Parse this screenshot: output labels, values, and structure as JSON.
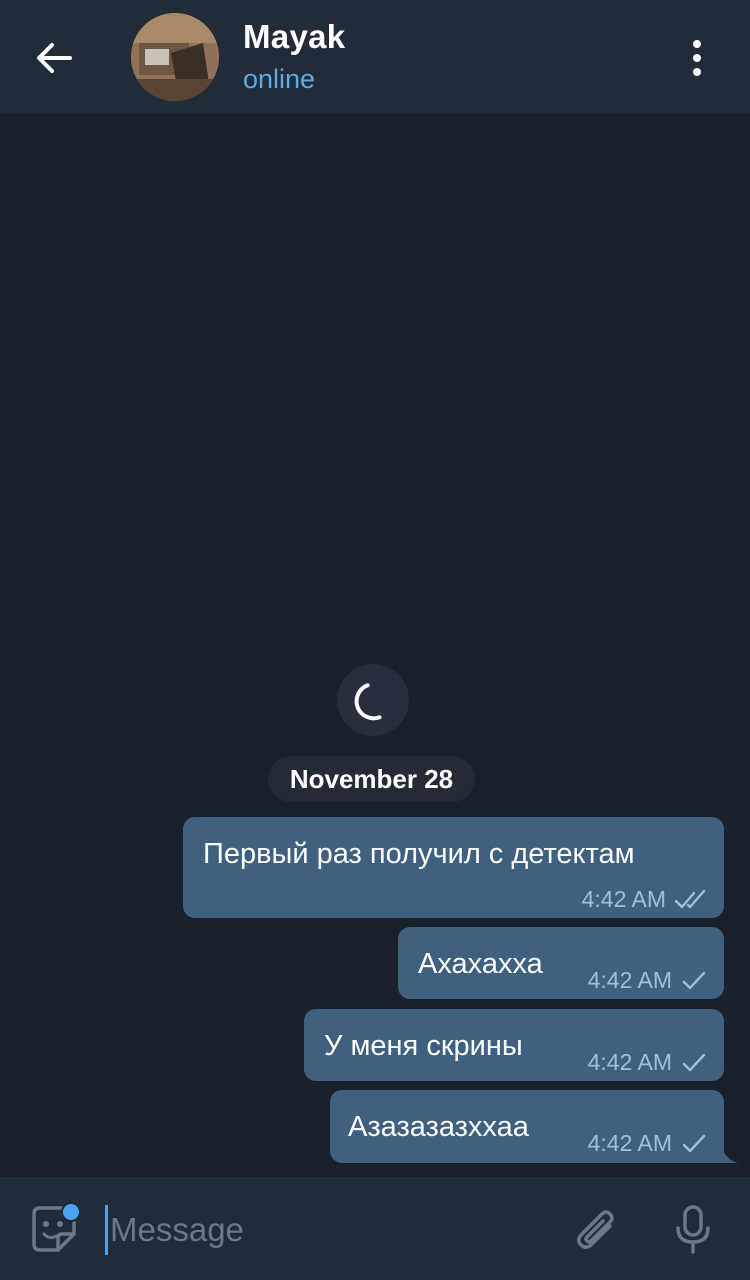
{
  "header": {
    "title": "Mayak",
    "status": "online",
    "back_icon": "arrow-left-icon",
    "menu_icon": "more-vertical-icon"
  },
  "chat": {
    "date": "November 28",
    "messages": [
      {
        "text": "Первый раз получил с детектам",
        "time": "4:42 AM",
        "status": "read"
      },
      {
        "text": "Ахахахха",
        "time": "4:42 AM",
        "status": "sent"
      },
      {
        "text": "У меня скрины",
        "time": "4:42 AM",
        "status": "sent"
      },
      {
        "text": "Азазазазххаа",
        "time": "4:42 AM",
        "status": "sent"
      }
    ]
  },
  "composer": {
    "placeholder": "Message",
    "sticker_icon": "sticker-icon",
    "attach_icon": "paperclip-icon",
    "mic_icon": "microphone-icon"
  },
  "colors": {
    "background": "#1a212b",
    "header": "#222c38",
    "bubble_out": "#40607f",
    "accent": "#5aabe8",
    "meta": "#9fc0dd"
  }
}
